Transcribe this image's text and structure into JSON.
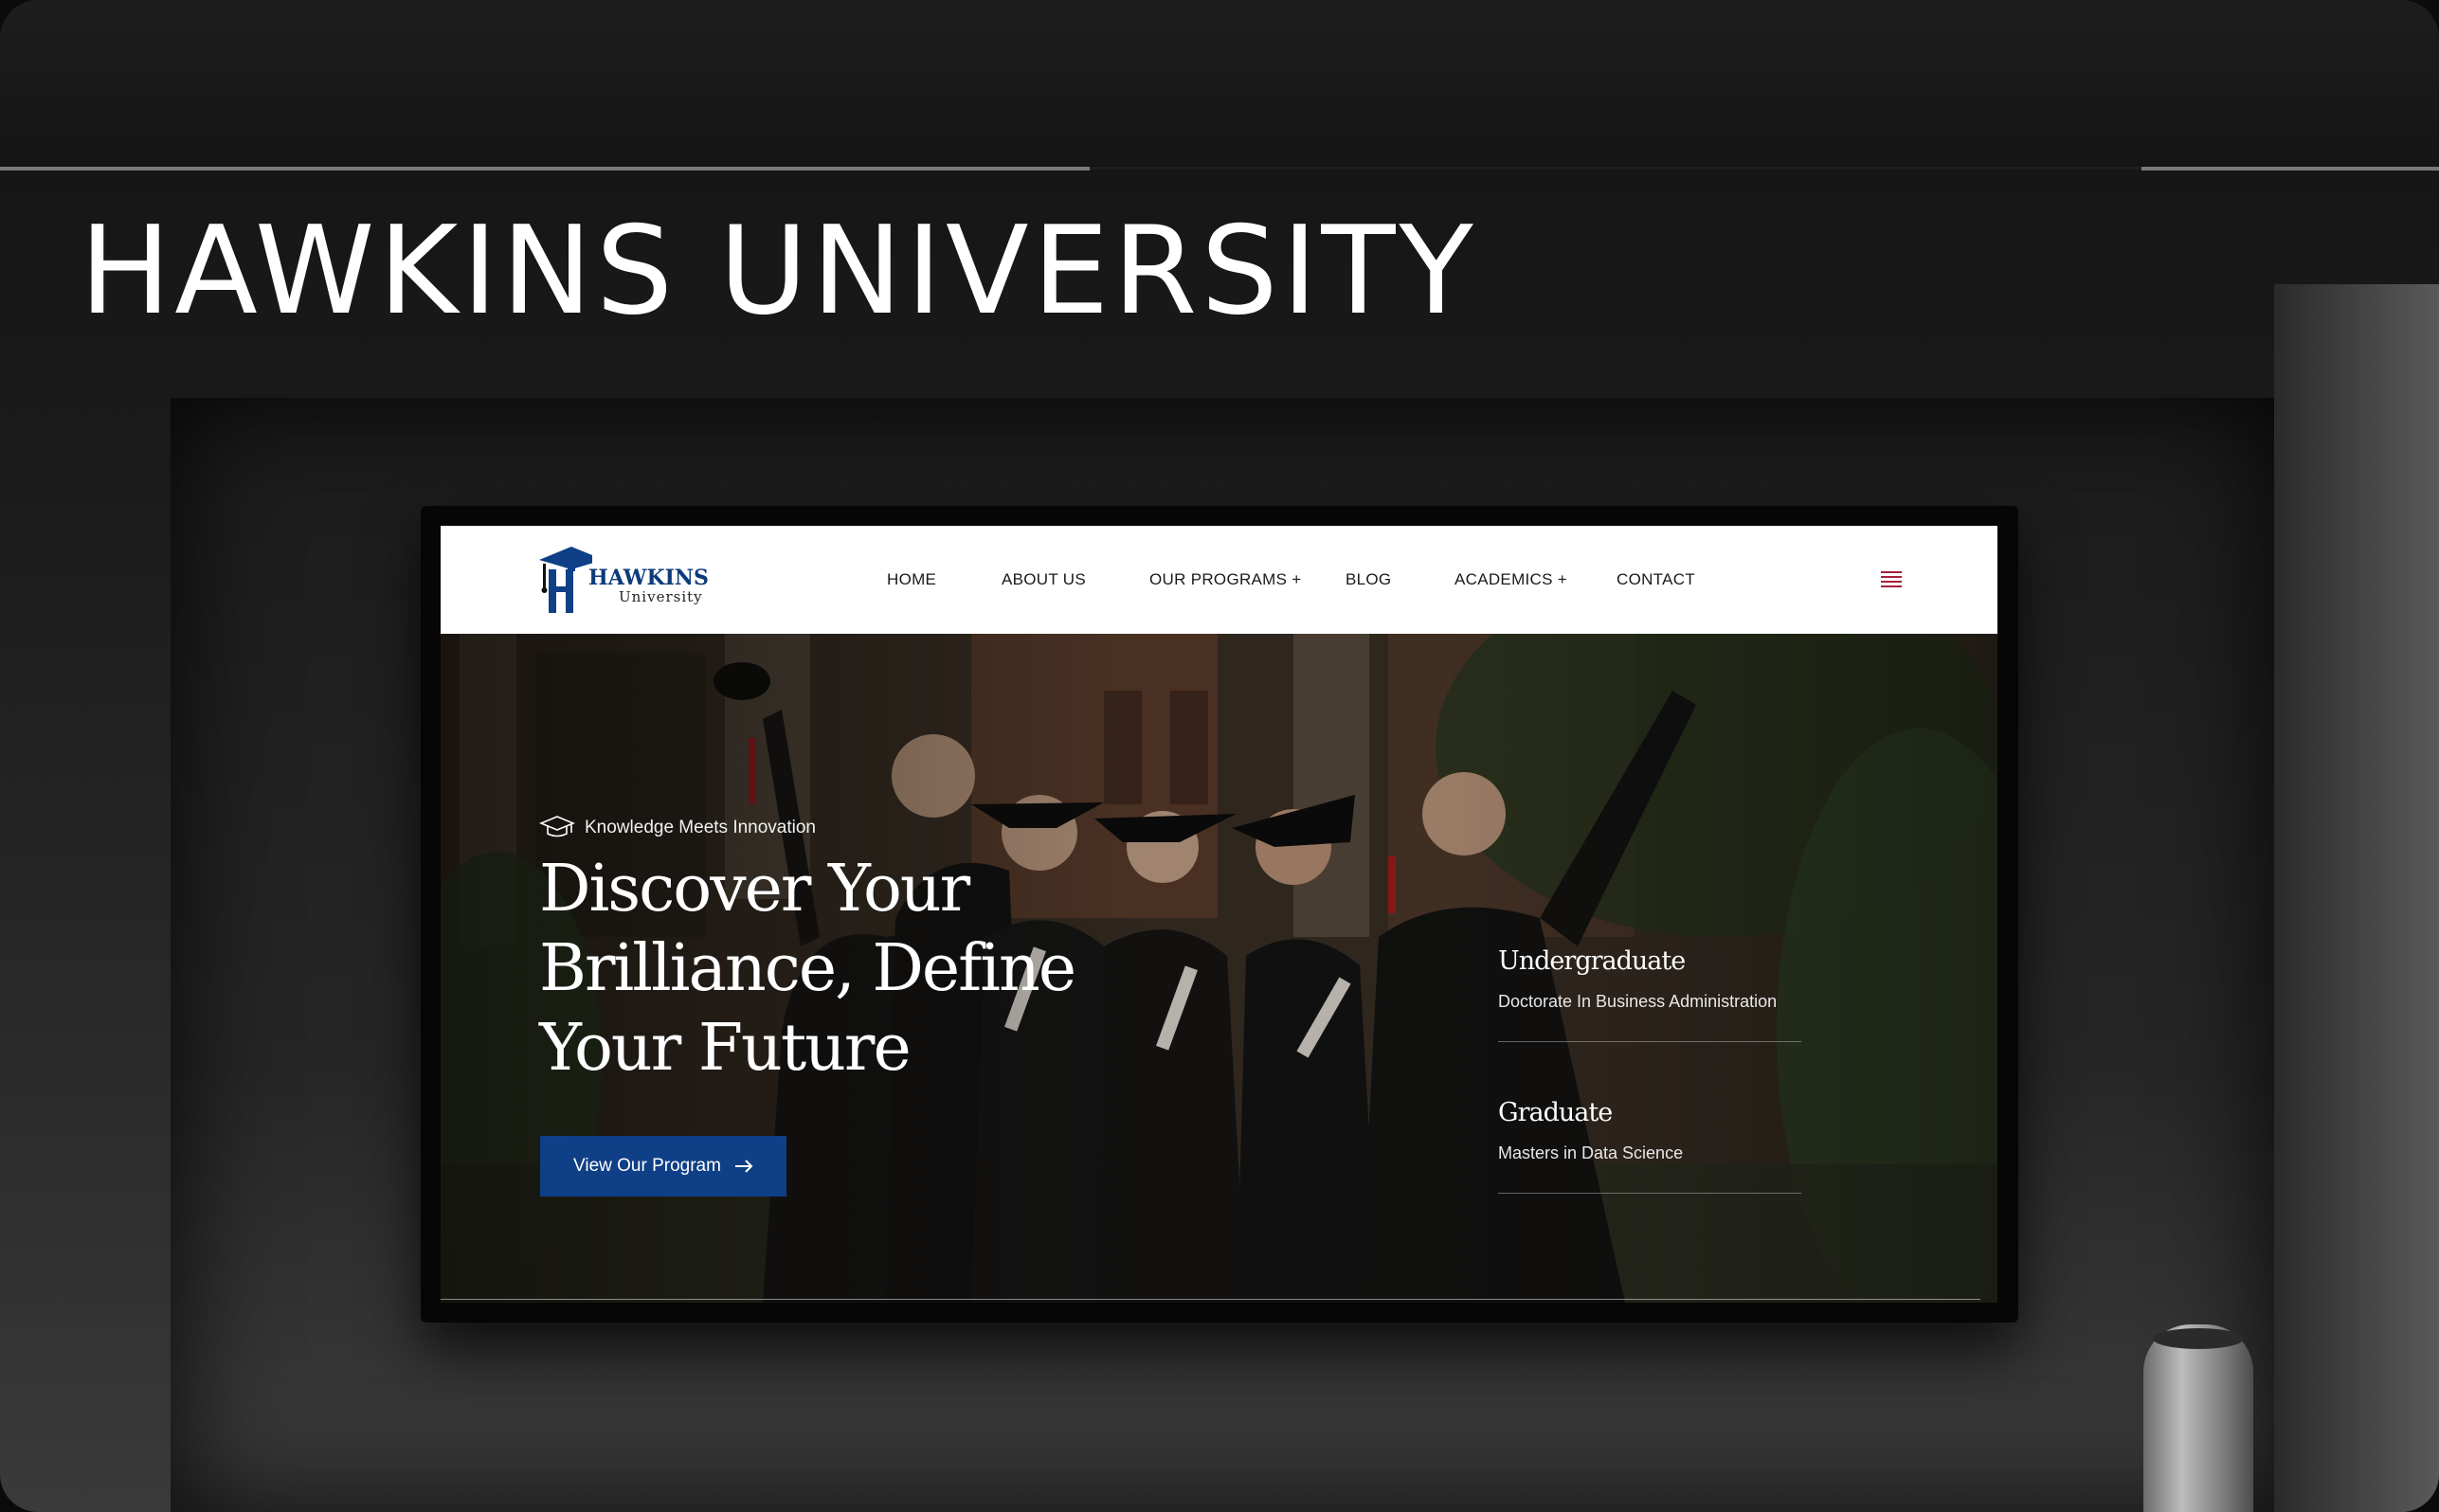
{
  "poster": {
    "headline": "HAWKINS UNIVERSITY"
  },
  "site": {
    "logo": {
      "name": "HAWKINS",
      "sub": "University"
    },
    "nav": {
      "items": [
        {
          "label": "HOME"
        },
        {
          "label": "ABOUT US"
        },
        {
          "label": "OUR PROGRAMS +"
        },
        {
          "label": "BLOG"
        },
        {
          "label": "ACADEMICS +"
        },
        {
          "label": "CONTACT"
        }
      ],
      "menu_icon": "hamburger-menu-icon"
    },
    "hero": {
      "tagline": "Knowledge Meets Innovation",
      "title_lines": [
        "Discover Your",
        "Brilliance, Define",
        "Your Future"
      ],
      "cta_label": "View Our Program",
      "programs": [
        {
          "title": "Undergraduate",
          "subtitle": "Doctorate In Business Administration"
        },
        {
          "title": "Graduate",
          "subtitle": "Masters in Data Science"
        }
      ]
    }
  },
  "colors": {
    "brand_blue": "#0f3f86",
    "menu_accent": "#a4213a",
    "nav_background": "#ffffff"
  }
}
